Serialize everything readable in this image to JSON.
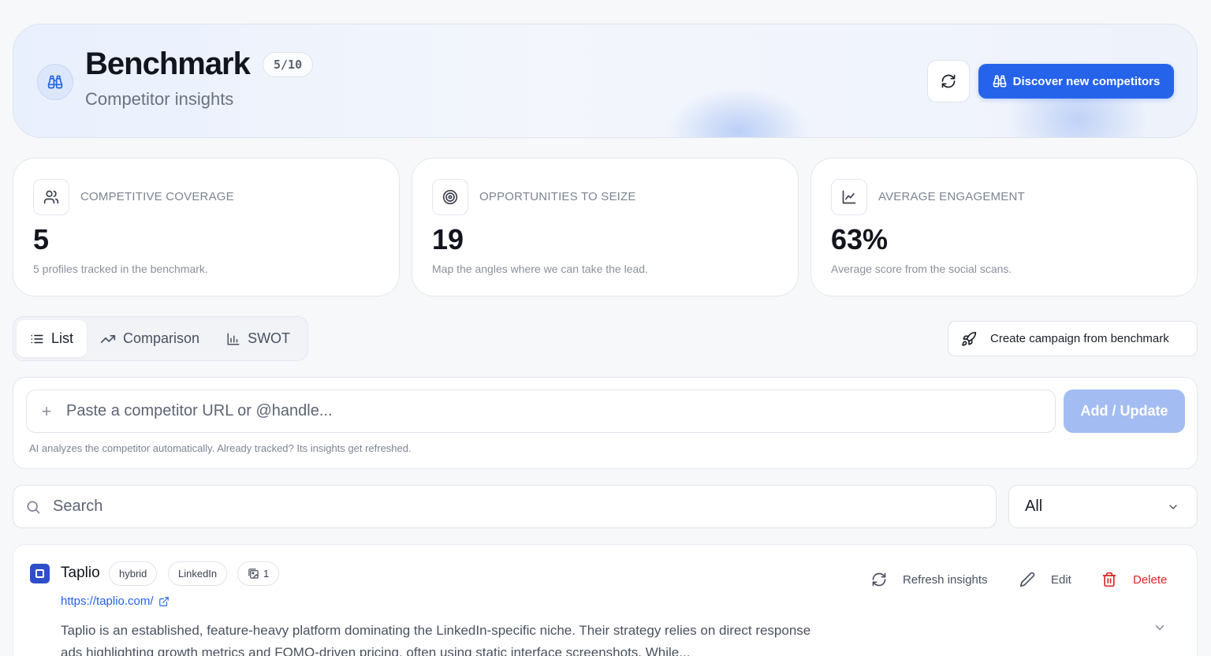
{
  "header": {
    "title": "Benchmark",
    "score_badge": "5/10",
    "subtitle": "Competitor insights",
    "icon": "binoculars-icon",
    "refresh_icon": "refresh-icon",
    "discover_label": "Discover new competitors",
    "accent_color": "#2563eb"
  },
  "stats": [
    {
      "icon": "users-icon",
      "label": "COMPETITIVE COVERAGE",
      "value": "5",
      "description": "5 profiles tracked in the benchmark."
    },
    {
      "icon": "target-icon",
      "label": "OPPORTUNITIES TO SEIZE",
      "value": "19",
      "description": "Map the angles where we can take the lead."
    },
    {
      "icon": "line-chart-icon",
      "label": "AVERAGE ENGAGEMENT",
      "value": "63%",
      "description": "Average score from the social scans."
    }
  ],
  "tabs": [
    {
      "label": "List",
      "icon": "list-icon",
      "active": true
    },
    {
      "label": "Comparison",
      "icon": "trend-icon",
      "active": false
    },
    {
      "label": "SWOT",
      "icon": "bar-chart-icon",
      "active": false
    }
  ],
  "campaign_button": {
    "label": "Create campaign from benchmark",
    "icon": "rocket-icon"
  },
  "add_competitor": {
    "placeholder": "Paste a competitor URL or @handle...",
    "button_label": "Add / Update",
    "hint": "AI analyzes the competitor automatically. Already tracked? Its insights get refreshed."
  },
  "search": {
    "placeholder": "Search"
  },
  "filter": {
    "selected": "All"
  },
  "competitors": [
    {
      "name": "Taplio",
      "tags": [
        "hybrid",
        "LinkedIn"
      ],
      "image_count": "1",
      "url": "https://taplio.com/",
      "description": "Taplio is an established, feature-heavy platform dominating the LinkedIn-specific niche. Their strategy relies on direct response ads highlighting growth metrics and FOMO-driven pricing, often using static interface screenshots. While...",
      "actions": {
        "refresh": "Refresh insights",
        "edit": "Edit",
        "delete": "Delete"
      }
    }
  ]
}
